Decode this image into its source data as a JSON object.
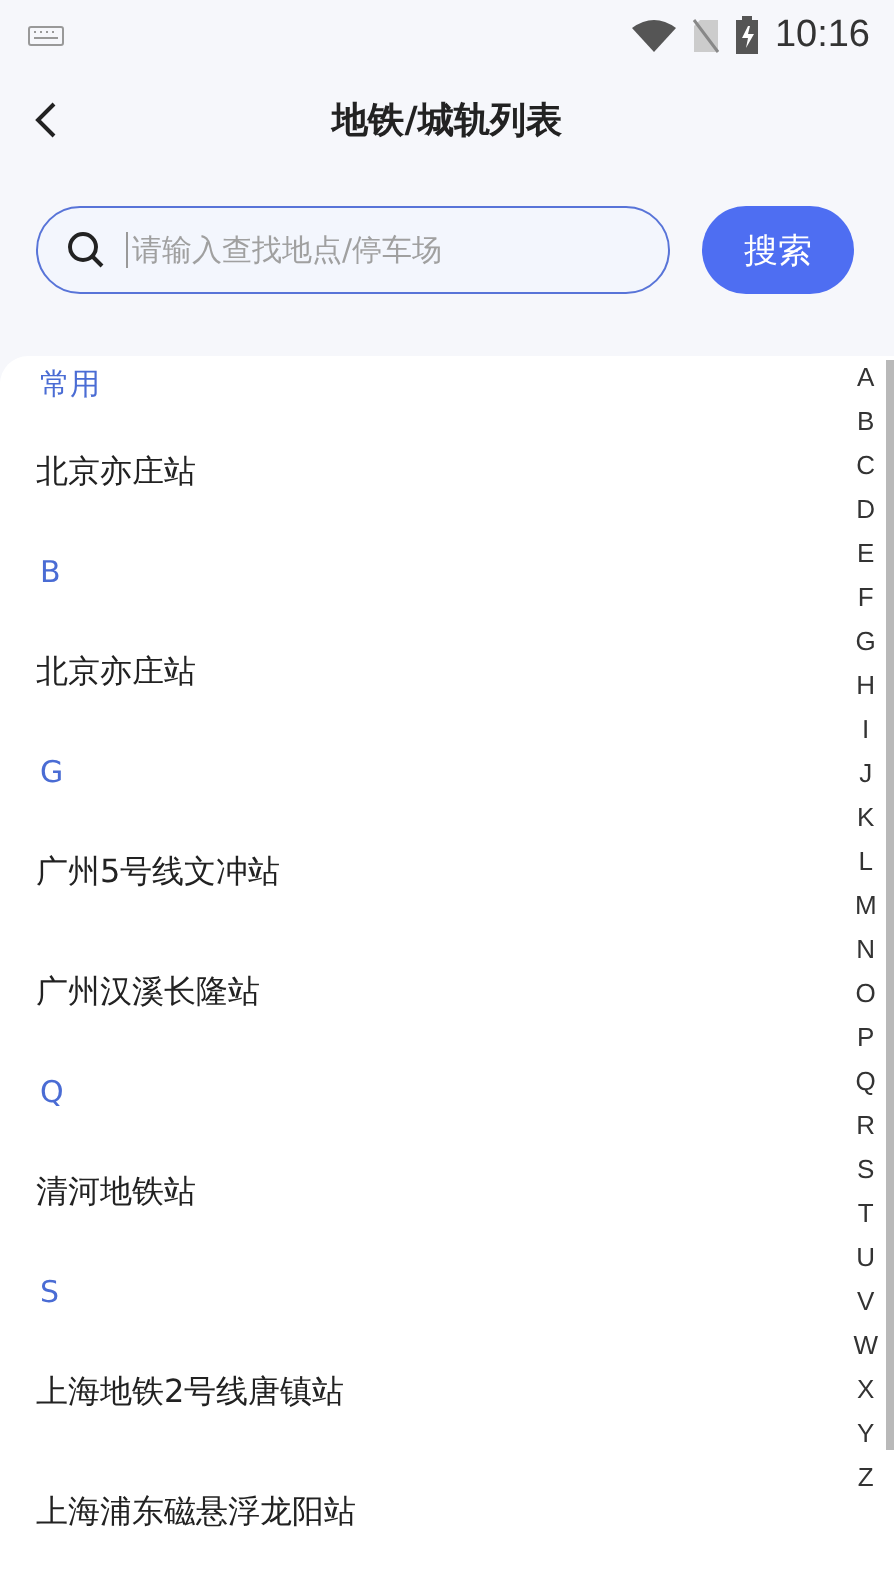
{
  "status_bar": {
    "time": "10:16"
  },
  "header": {
    "title": "地铁/城轨列表"
  },
  "search": {
    "placeholder": "请输入查找地点/停车场",
    "button": "搜索"
  },
  "sections": [
    {
      "title": "常用",
      "items": [
        "北京亦庄站"
      ]
    },
    {
      "title": "B",
      "items": [
        "北京亦庄站"
      ]
    },
    {
      "title": "G",
      "items": [
        "广州5号线文冲站",
        "广州汉溪长隆站"
      ]
    },
    {
      "title": "Q",
      "items": [
        "清河地铁站"
      ]
    },
    {
      "title": "S",
      "items": [
        "上海地铁2号线唐镇站",
        "上海浦东磁悬浮龙阳站"
      ]
    }
  ],
  "index_letters": [
    "A",
    "B",
    "C",
    "D",
    "E",
    "F",
    "G",
    "H",
    "I",
    "J",
    "K",
    "L",
    "M",
    "N",
    "O",
    "P",
    "Q",
    "R",
    "S",
    "T",
    "U",
    "V",
    "W",
    "X",
    "Y",
    "Z"
  ]
}
